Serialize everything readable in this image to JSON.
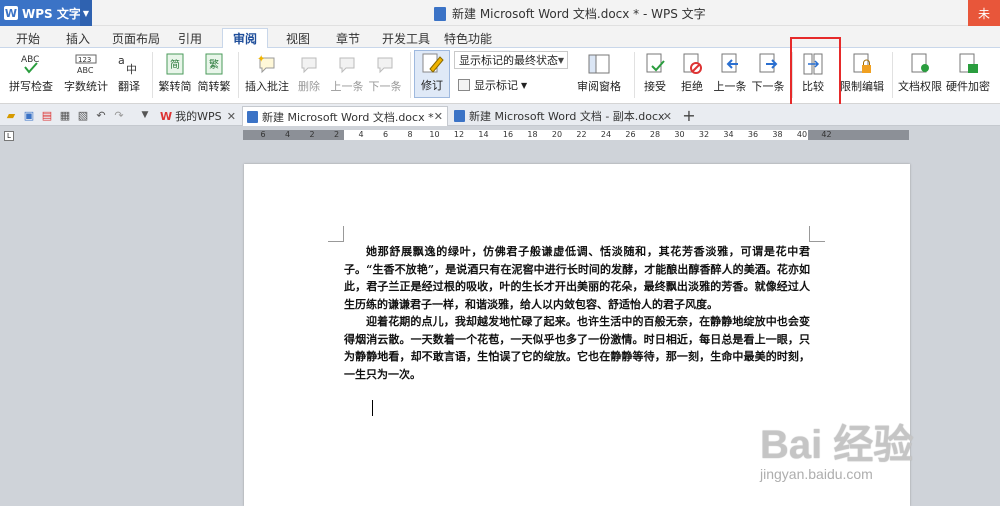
{
  "titlebar": {
    "app_button": "WPS 文字",
    "window_title": "新建 Microsoft Word 文档.docx * - WPS 文字",
    "right_button": "未"
  },
  "menu_tabs": [
    "开始",
    "插入",
    "页面布局",
    "引用",
    "审阅",
    "视图",
    "章节",
    "开发工具",
    "特色功能"
  ],
  "active_menu_tab": "审阅",
  "ribbon": {
    "spellcheck": "拼写检查",
    "wordcount": "字数统计",
    "translate": "翻译",
    "trad_to_simp": "繁转简",
    "simp_to_trad": "简转繁",
    "insert_comment": "插入批注",
    "delete": "删除",
    "prev_comment": "上一条",
    "next_comment": "下一条",
    "revise": "修订",
    "markup_combo": "显示标记的最终状态",
    "show_markup": "显示标记",
    "review_pane": "审阅窗格",
    "accept": "接受",
    "reject": "拒绝",
    "prev_change": "上一条",
    "next_change": "下一条",
    "compare": "比较",
    "restrict_edit": "限制编辑",
    "doc_permission": "文档权限",
    "hw_encrypt": "硬件加密"
  },
  "doc_tabs": {
    "home": "我的WPS",
    "tab1": "新建 Microsoft Word 文档.docx *",
    "tab2": "新建 Microsoft Word 文档 - 副本.docx",
    "new_tab": "+"
  },
  "ruler_numbers": [
    "6",
    "4",
    "2",
    "2",
    "4",
    "6",
    "8",
    "10",
    "12",
    "14",
    "16",
    "18",
    "20",
    "22",
    "24",
    "26",
    "28",
    "30",
    "32",
    "34",
    "36",
    "38",
    "40",
    "42"
  ],
  "document": {
    "paragraph1": "她那舒展飘逸的绿叶，仿佛君子般谦虚低调、恬淡随和，其花芳香淡雅，可谓是花中君子。“生香不放艳”，是说酒只有在泥窖中进行长时间的发酵，才能酿出醇香醉人的美酒。花亦如此，君子兰正是经过根的吸收，叶的生长才开出美丽的花朵，最终飘出淡雅的芳香。就像经过人生历练的谦谦君子一样，和谐淡雅，给人以内敛包容、舒适怡人的君子风度。",
    "paragraph2": "迎着花期的点儿，我却越发地忙碌了起来。也许生活中的百般无奈，在静静地绽放中也会变得烟消云散。一天数着一个花苞，一天似乎也多了一份激情。时日相近，每日总是看上一眼，只为静静地看，却不敢言语，生怕误了它的绽放。它也在静静等待，那一刻，生命中最美的时刻，一生只为一次。"
  },
  "watermark": {
    "main": "Bai 经验",
    "sub": "jingyan.baidu.com"
  },
  "colors": {
    "wps_blue": "#3b73c6",
    "highlight": "#e62a2a",
    "login_red": "#e8563a"
  }
}
